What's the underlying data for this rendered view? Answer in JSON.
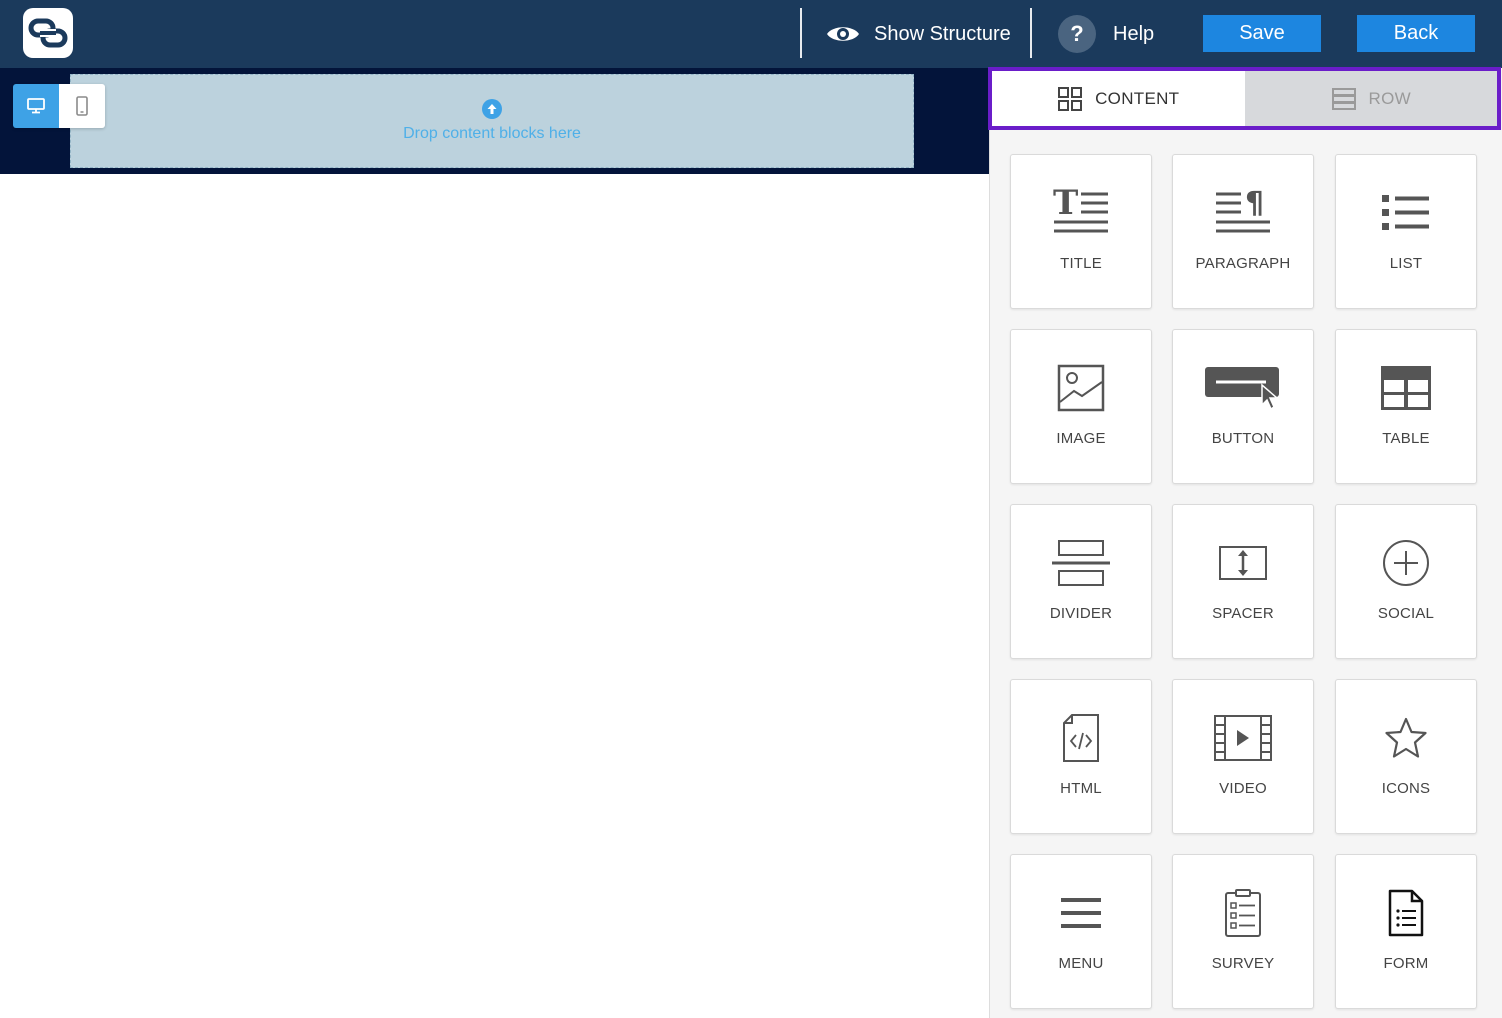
{
  "header": {
    "show_structure_label": "Show Structure",
    "help_label": "Help",
    "help_symbol": "?",
    "save_label": "Save",
    "back_label": "Back"
  },
  "canvas": {
    "drop_text": "Drop content blocks here"
  },
  "sidebar": {
    "tabs": [
      {
        "label": "CONTENT",
        "active": true
      },
      {
        "label": "ROW",
        "active": false
      }
    ],
    "blocks": [
      {
        "label": "TITLE",
        "icon": "title-icon"
      },
      {
        "label": "PARAGRAPH",
        "icon": "paragraph-icon"
      },
      {
        "label": "LIST",
        "icon": "list-icon"
      },
      {
        "label": "IMAGE",
        "icon": "image-icon"
      },
      {
        "label": "BUTTON",
        "icon": "button-icon"
      },
      {
        "label": "TABLE",
        "icon": "table-icon"
      },
      {
        "label": "DIVIDER",
        "icon": "divider-icon"
      },
      {
        "label": "SPACER",
        "icon": "spacer-icon"
      },
      {
        "label": "SOCIAL",
        "icon": "social-icon"
      },
      {
        "label": "HTML",
        "icon": "html-icon"
      },
      {
        "label": "VIDEO",
        "icon": "video-icon"
      },
      {
        "label": "ICONS",
        "icon": "star-icon"
      },
      {
        "label": "MENU",
        "icon": "menu-icon"
      },
      {
        "label": "SURVEY",
        "icon": "survey-icon"
      },
      {
        "label": "FORM",
        "icon": "form-icon"
      }
    ]
  },
  "colors": {
    "topbar": "#1b3a5c",
    "accent_button": "#1d86e0",
    "tab_highlight": "#6a1dc9",
    "canvas_band": "#03143a",
    "drop_zone": "#bcd2dd"
  }
}
